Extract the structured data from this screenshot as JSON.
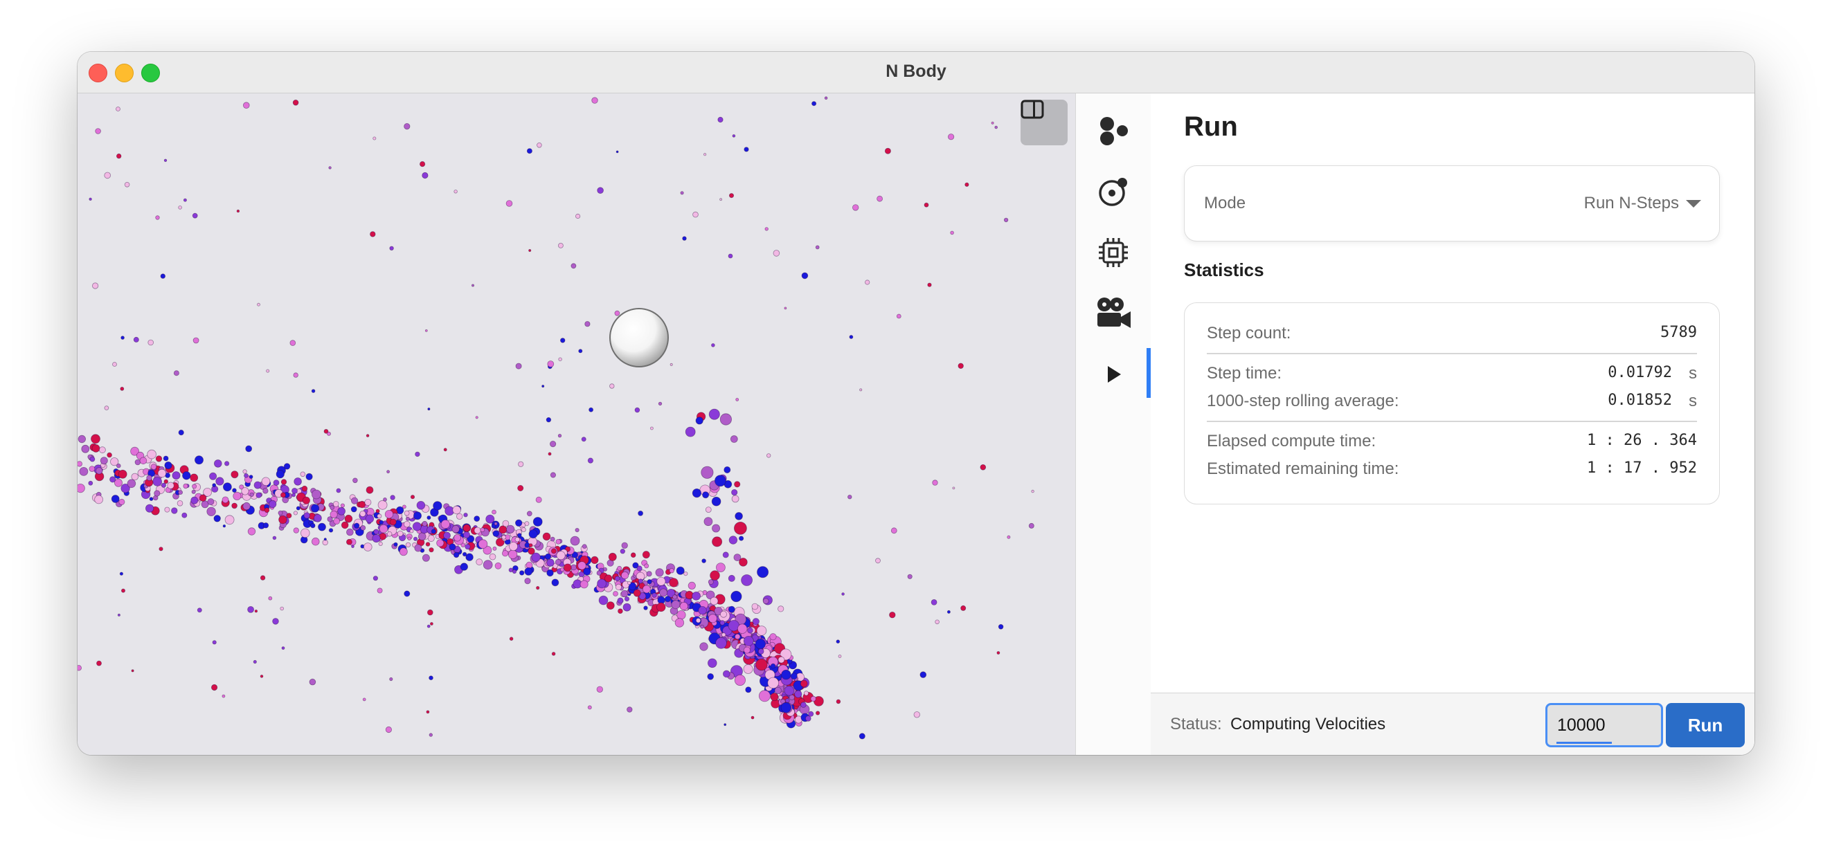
{
  "window": {
    "title": "N Body"
  },
  "rail": {
    "items": [
      {
        "icon": "particles-icon"
      },
      {
        "icon": "orbit-icon"
      },
      {
        "icon": "chip-icon"
      },
      {
        "icon": "video-camera-icon"
      },
      {
        "icon": "play-icon",
        "active": true
      }
    ]
  },
  "panel": {
    "title": "Run",
    "mode": {
      "label": "Mode",
      "value": "Run N-Steps"
    },
    "statistics": {
      "heading": "Statistics",
      "step_count": {
        "label": "Step count:",
        "value": "5789"
      },
      "step_time": {
        "label": "Step time:",
        "value": "0.01792",
        "unit": "s"
      },
      "rolling_avg": {
        "label": "1000-step rolling average:",
        "value": "0.01852",
        "unit": "s"
      },
      "elapsed": {
        "label": "Elapsed compute time:",
        "value": "1 : 26 . 364"
      },
      "remaining": {
        "label": "Estimated remaining time:",
        "value": "1 : 17 . 952"
      }
    }
  },
  "statusbar": {
    "label": "Status:",
    "value": "Computing Velocities",
    "steps_value": "10000",
    "run_label": "Run"
  },
  "colors": {
    "viewport_bg": "#e6e5ea",
    "accent": "#2f7ef5",
    "run_button": "#2a6dc8",
    "particle_blue": "#1a1adc",
    "particle_red": "#d4104a",
    "particle_pink": "#e070d8"
  }
}
